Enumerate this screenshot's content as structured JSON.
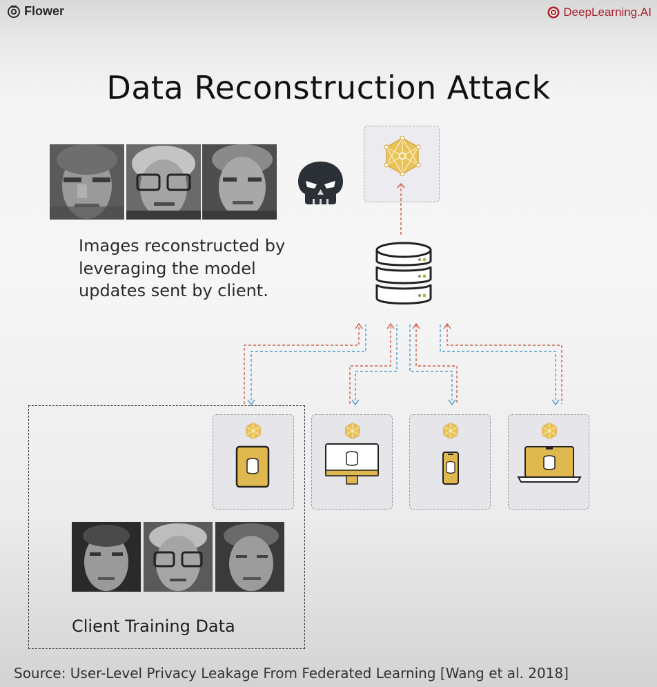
{
  "header": {
    "brand_left": "Flower",
    "brand_right": "DeepLearning.AI"
  },
  "title": "Data Reconstruction Attack",
  "caption": "Images reconstructed by leveraging the model updates sent by client.",
  "client_label": "Client Training Data",
  "source": "Source: User-Level Privacy Leakage From Federated Learning [Wang et al. 2018]",
  "icons": {
    "attacker": "skull-icon",
    "global_model": "network-model-icon",
    "server": "database-server-icon",
    "devices": [
      "tablet-icon",
      "desktop-icon",
      "phone-icon",
      "laptop-icon"
    ]
  },
  "colors": {
    "upload_arrow": "#d0604a",
    "download_arrow": "#4a9ad0",
    "accent_gold": "#e0b850",
    "brand_red": "#a8202a"
  }
}
